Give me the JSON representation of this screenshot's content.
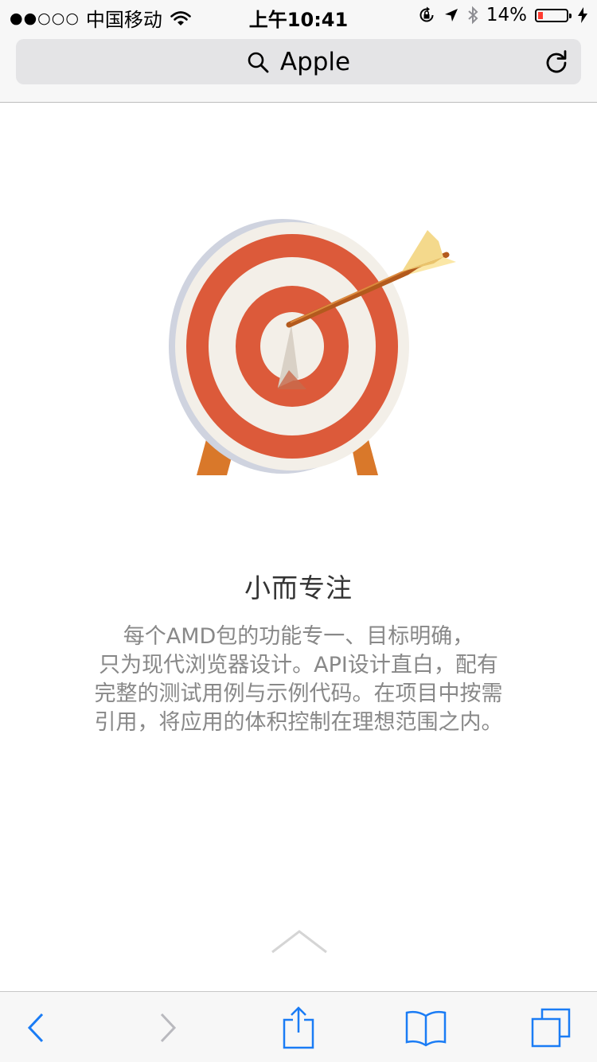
{
  "status_bar": {
    "signal": "●●○○○",
    "carrier": "中国移动",
    "time": "上午10:41",
    "battery_percent": "14%",
    "battery_level": 0.14,
    "icons": [
      "wifi-icon",
      "orientation-lock-icon",
      "location-arrow-icon",
      "bluetooth-icon",
      "battery-icon",
      "charging-bolt-icon"
    ]
  },
  "address_bar": {
    "text": "Apple",
    "icons": [
      "search-icon",
      "reload-icon"
    ]
  },
  "content": {
    "title": "小而专注",
    "description_lines": [
      "每个AMD包的功能专一、目标明确，",
      "只为现代浏览器设计。API设计直白，配有",
      "完整的测试用例与示例代码。在项目中按需",
      "引用，将应用的体积控制在理想范围之内。"
    ],
    "illustration": "target-with-arrow-illustration"
  },
  "toolbar": {
    "buttons": [
      "back-icon",
      "forward-icon",
      "share-icon",
      "bookmarks-icon",
      "tabs-icon"
    ]
  },
  "colors": {
    "accent": "#1a7cf5",
    "disabled": "#b9b9be",
    "target_red": "#dc5a3a",
    "target_cream": "#f4f0ea"
  }
}
